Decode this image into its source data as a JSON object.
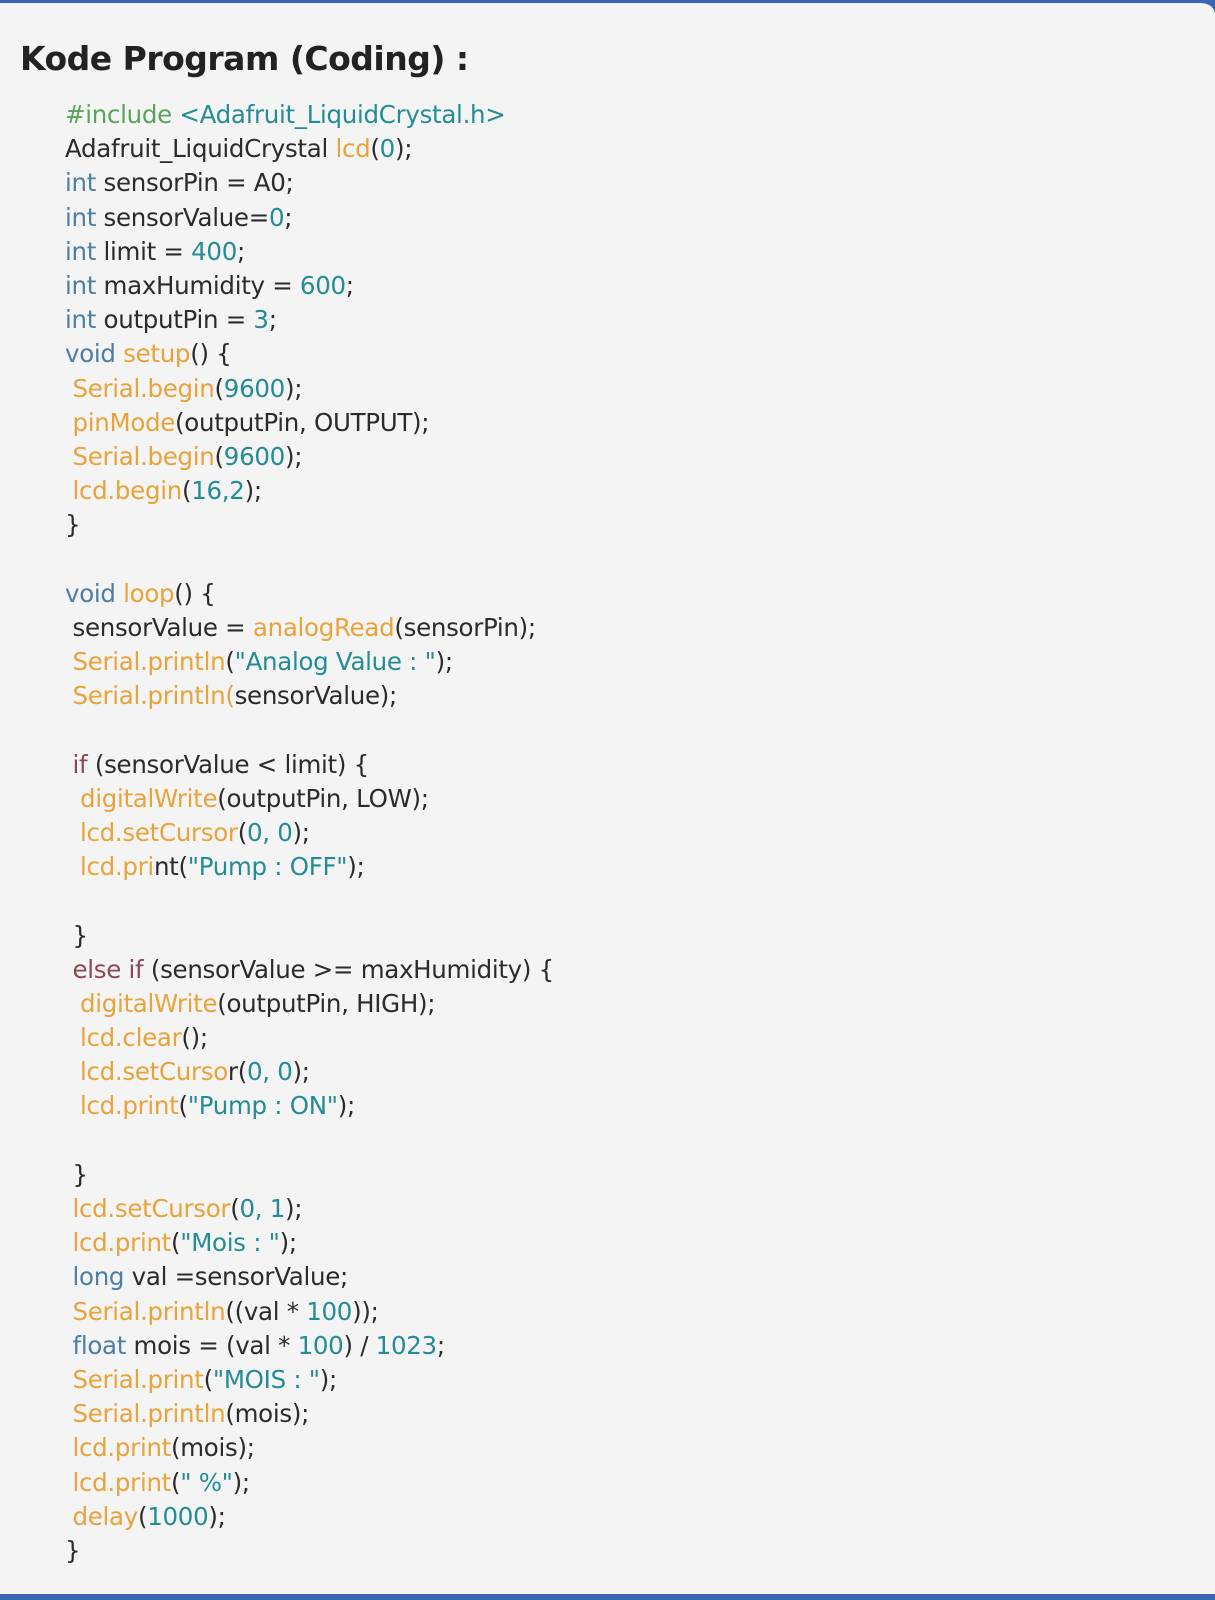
{
  "title": "Kode Program (Coding) :",
  "colors": {
    "keyword": "#4e7ea6",
    "control": "#8a4a54",
    "function": "#e9a33a",
    "number": "#238c94",
    "string": "#238c94",
    "preprocessor": "#5aa45a",
    "text": "#2b2b2b",
    "frame": "#3b66b5"
  },
  "code_lines": [
    [
      [
        "pp",
        "#include "
      ],
      [
        "inc",
        "<Adafruit_LiquidCrystal.h>"
      ]
    ],
    [
      [
        "id",
        "Adafruit_LiquidCrystal "
      ],
      [
        "fn",
        "lcd"
      ],
      [
        "id",
        "("
      ],
      [
        "num",
        "0"
      ],
      [
        "id",
        ");"
      ]
    ],
    [
      [
        "kw",
        "int"
      ],
      [
        "id",
        " sensorPin = A0;"
      ]
    ],
    [
      [
        "kw",
        "int"
      ],
      [
        "id",
        " sensorValue="
      ],
      [
        "num",
        "0"
      ],
      [
        "id",
        ";"
      ]
    ],
    [
      [
        "kw",
        "int"
      ],
      [
        "id",
        " limit = "
      ],
      [
        "num",
        "400"
      ],
      [
        "id",
        ";"
      ]
    ],
    [
      [
        "kw",
        "int"
      ],
      [
        "id",
        " maxHumidity = "
      ],
      [
        "num",
        "600"
      ],
      [
        "id",
        ";"
      ]
    ],
    [
      [
        "kw",
        "int"
      ],
      [
        "id",
        " outputPin = "
      ],
      [
        "num",
        "3"
      ],
      [
        "id",
        ";"
      ]
    ],
    [
      [
        "kw",
        "void"
      ],
      [
        "id",
        " "
      ],
      [
        "fn",
        "setup"
      ],
      [
        "id",
        "() {"
      ]
    ],
    [
      [
        "id",
        " "
      ],
      [
        "fn",
        "Serial.begin"
      ],
      [
        "id",
        "("
      ],
      [
        "num",
        "9600"
      ],
      [
        "id",
        ");"
      ]
    ],
    [
      [
        "id",
        " "
      ],
      [
        "fn",
        "pinMode"
      ],
      [
        "id",
        "(outputPin, OUTPUT);"
      ]
    ],
    [
      [
        "id",
        " "
      ],
      [
        "fn",
        "Serial.begin"
      ],
      [
        "id",
        "("
      ],
      [
        "num",
        "9600"
      ],
      [
        "id",
        ");"
      ]
    ],
    [
      [
        "id",
        " "
      ],
      [
        "fn",
        "lcd.begin"
      ],
      [
        "id",
        "("
      ],
      [
        "num",
        "16,2"
      ],
      [
        "id",
        ");"
      ]
    ],
    [
      [
        "id",
        "}"
      ]
    ],
    [],
    [
      [
        "kw",
        "void"
      ],
      [
        "id",
        " "
      ],
      [
        "fn",
        "loop"
      ],
      [
        "id",
        "() {"
      ]
    ],
    [
      [
        "id",
        " sensorValue = "
      ],
      [
        "fn",
        "analogRead"
      ],
      [
        "id",
        "(sensorPin);"
      ]
    ],
    [
      [
        "id",
        " "
      ],
      [
        "fn",
        "Serial.println"
      ],
      [
        "id",
        "("
      ],
      [
        "str",
        "\"Analog Value : \""
      ],
      [
        "id",
        ");"
      ]
    ],
    [
      [
        "id",
        " "
      ],
      [
        "fn",
        "Serial.println("
      ],
      [
        "id",
        "sensorValue);"
      ]
    ],
    [],
    [
      [
        "id",
        " "
      ],
      [
        "ctl",
        "if"
      ],
      [
        "id",
        " (sensorValue < limit) {"
      ]
    ],
    [
      [
        "id",
        "  "
      ],
      [
        "fn",
        "digitalWrite"
      ],
      [
        "id",
        "(outputPin, LOW);"
      ]
    ],
    [
      [
        "id",
        "  "
      ],
      [
        "fn",
        "lcd.setCursor"
      ],
      [
        "id",
        "("
      ],
      [
        "num",
        "0, 0"
      ],
      [
        "id",
        ");"
      ]
    ],
    [
      [
        "id",
        "  "
      ],
      [
        "fn",
        "lcd.pri"
      ],
      [
        "id",
        "nt("
      ],
      [
        "str",
        "\"Pump : OFF\""
      ],
      [
        "id",
        ");"
      ]
    ],
    [],
    [
      [
        "id",
        " }"
      ]
    ],
    [
      [
        "id",
        " "
      ],
      [
        "ctl",
        "else if"
      ],
      [
        "id",
        " (sensorValue >= maxHumidity) {"
      ]
    ],
    [
      [
        "id",
        "  "
      ],
      [
        "fn",
        "digitalWrite"
      ],
      [
        "id",
        "(outputPin, HIGH);"
      ]
    ],
    [
      [
        "id",
        "  "
      ],
      [
        "fn",
        "lcd.clear"
      ],
      [
        "id",
        "();"
      ]
    ],
    [
      [
        "id",
        "  "
      ],
      [
        "fn",
        "lcd.setCurso"
      ],
      [
        "id",
        "r("
      ],
      [
        "num",
        "0, 0"
      ],
      [
        "id",
        ");"
      ]
    ],
    [
      [
        "id",
        "  "
      ],
      [
        "fn",
        "lcd.print"
      ],
      [
        "id",
        "("
      ],
      [
        "str",
        "\"Pump : ON\""
      ],
      [
        "id",
        ");"
      ]
    ],
    [],
    [
      [
        "id",
        " }"
      ]
    ],
    [
      [
        "id",
        " "
      ],
      [
        "fn",
        "lcd.setCursor"
      ],
      [
        "id",
        "("
      ],
      [
        "num",
        "0, 1"
      ],
      [
        "id",
        ");"
      ]
    ],
    [
      [
        "id",
        " "
      ],
      [
        "fn",
        "lcd.print"
      ],
      [
        "id",
        "("
      ],
      [
        "str",
        "\"Mois : \""
      ],
      [
        "id",
        ");"
      ]
    ],
    [
      [
        "id",
        " "
      ],
      [
        "kw",
        "long"
      ],
      [
        "id",
        " val =sensorValue;"
      ]
    ],
    [
      [
        "id",
        " "
      ],
      [
        "fn",
        "Serial.println"
      ],
      [
        "id",
        "((val * "
      ],
      [
        "num",
        "100"
      ],
      [
        "id",
        "));"
      ]
    ],
    [
      [
        "id",
        " "
      ],
      [
        "kw",
        "float"
      ],
      [
        "id",
        " mois = (val * "
      ],
      [
        "num",
        "100"
      ],
      [
        "id",
        ") / "
      ],
      [
        "num",
        "1023"
      ],
      [
        "id",
        ";"
      ]
    ],
    [
      [
        "id",
        " "
      ],
      [
        "fn",
        "Serial.print"
      ],
      [
        "id",
        "("
      ],
      [
        "str",
        "\"MOIS : \""
      ],
      [
        "id",
        ");"
      ]
    ],
    [
      [
        "id",
        " "
      ],
      [
        "fn",
        "Serial.println"
      ],
      [
        "id",
        "(mois);"
      ]
    ],
    [
      [
        "id",
        " "
      ],
      [
        "fn",
        "lcd.print"
      ],
      [
        "id",
        "(mois);"
      ]
    ],
    [
      [
        "id",
        " "
      ],
      [
        "fn",
        "lcd.print"
      ],
      [
        "id",
        "("
      ],
      [
        "str",
        "\" %\""
      ],
      [
        "id",
        ");"
      ]
    ],
    [
      [
        "id",
        " "
      ],
      [
        "fn",
        "delay"
      ],
      [
        "id",
        "("
      ],
      [
        "num",
        "1000"
      ],
      [
        "id",
        ");"
      ]
    ],
    [
      [
        "id",
        "}"
      ]
    ]
  ]
}
